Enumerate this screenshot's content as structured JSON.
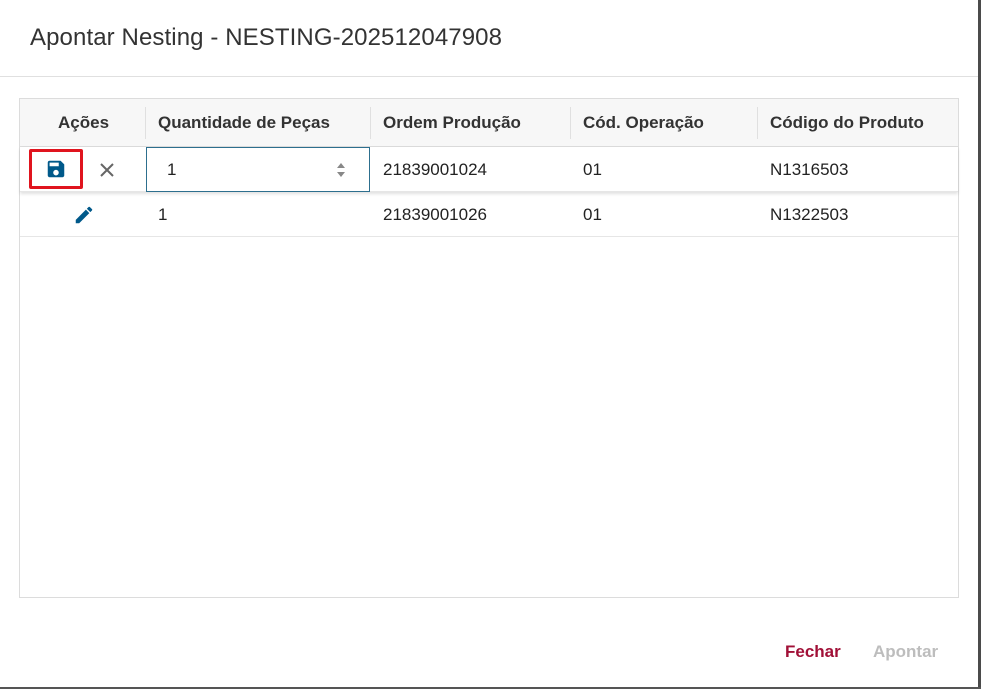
{
  "dialog": {
    "title": "Apontar Nesting - NESTING-202512047908"
  },
  "grid": {
    "columns": [
      {
        "label": "Ações"
      },
      {
        "label": "Quantidade de Peças"
      },
      {
        "label": "Ordem Produção"
      },
      {
        "label": "Cód. Operação"
      },
      {
        "label": "Código do Produto"
      }
    ],
    "rows": [
      {
        "quantidade": "1",
        "ordem": "21839001024",
        "operacao": "01",
        "produto": "N1316503",
        "editing": true
      },
      {
        "quantidade": "1",
        "ordem": "21839001026",
        "operacao": "01",
        "produto": "N1322503",
        "editing": false
      }
    ]
  },
  "icons": {
    "save": "save-icon",
    "cancel": "close-icon",
    "edit": "pencil-icon",
    "spinner": "spinner-arrows-icon"
  },
  "footer": {
    "close_label": "Fechar",
    "apontar_label": "Apontar"
  },
  "colors": {
    "accent": "#a11037",
    "icon_blue": "#00598a",
    "highlight": "#e0141e",
    "disabled": "#bdbdbd"
  }
}
